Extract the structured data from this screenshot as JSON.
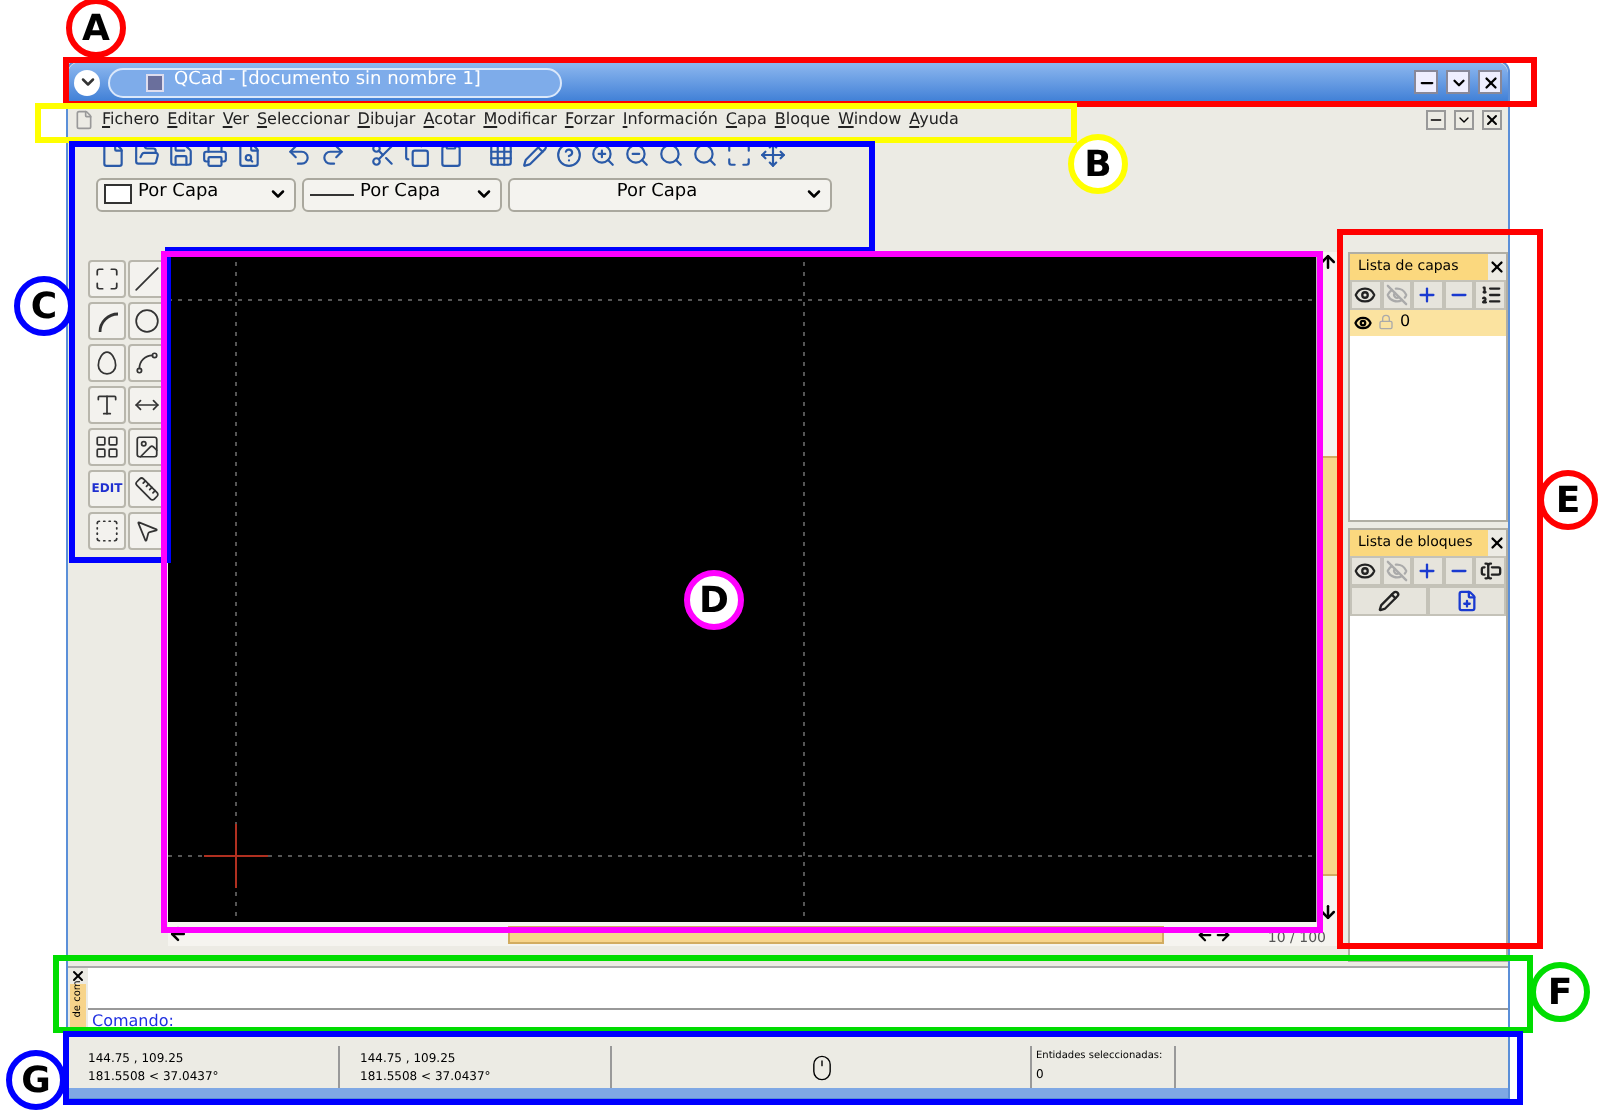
{
  "window": {
    "title": "QCad - [documento sin nombre 1]"
  },
  "menu": [
    {
      "label": "Fichero"
    },
    {
      "label": "Editar"
    },
    {
      "label": "Ver"
    },
    {
      "label": "Seleccionar"
    },
    {
      "label": "Dibujar"
    },
    {
      "label": "Acotar"
    },
    {
      "label": "Modificar"
    },
    {
      "label": "Forzar"
    },
    {
      "label": "Información"
    },
    {
      "label": "Capa"
    },
    {
      "label": "Bloque"
    },
    {
      "label": "Window"
    },
    {
      "label": "Ayuda"
    }
  ],
  "pen_toolbar": [
    {
      "label": "Por Capa",
      "kind": "color"
    },
    {
      "label": "Por Capa",
      "kind": "line"
    },
    {
      "label": "Por Capa",
      "kind": "plain"
    }
  ],
  "tool_palette": {
    "edit_label": "EDIT"
  },
  "scroll_info": "10 / 100",
  "layer_list": {
    "title": "Lista de capas",
    "layers": [
      {
        "name": "0",
        "selected": true
      }
    ]
  },
  "block_list": {
    "title": "Lista de bloques"
  },
  "command": {
    "tab": "de com",
    "label": "Comando:"
  },
  "status": {
    "coords": [
      {
        "line1": "144.75 , 109.25",
        "line2": "181.5508 < 37.0437°"
      },
      {
        "line1": "144.75 , 109.25",
        "line2": "181.5508 < 37.0437°"
      }
    ],
    "selected_label": "Entidades seleccionadas:",
    "selected_count": "0"
  },
  "annotations": [
    {
      "letter": "A",
      "color": "#ff0000"
    },
    {
      "letter": "B",
      "color": "#ffff00"
    },
    {
      "letter": "C",
      "color": "#0000ff"
    },
    {
      "letter": "D",
      "color": "#ff00ff"
    },
    {
      "letter": "E",
      "color": "#ff0000"
    },
    {
      "letter": "F",
      "color": "#00dd00"
    },
    {
      "letter": "G",
      "color": "#0000ff"
    }
  ]
}
